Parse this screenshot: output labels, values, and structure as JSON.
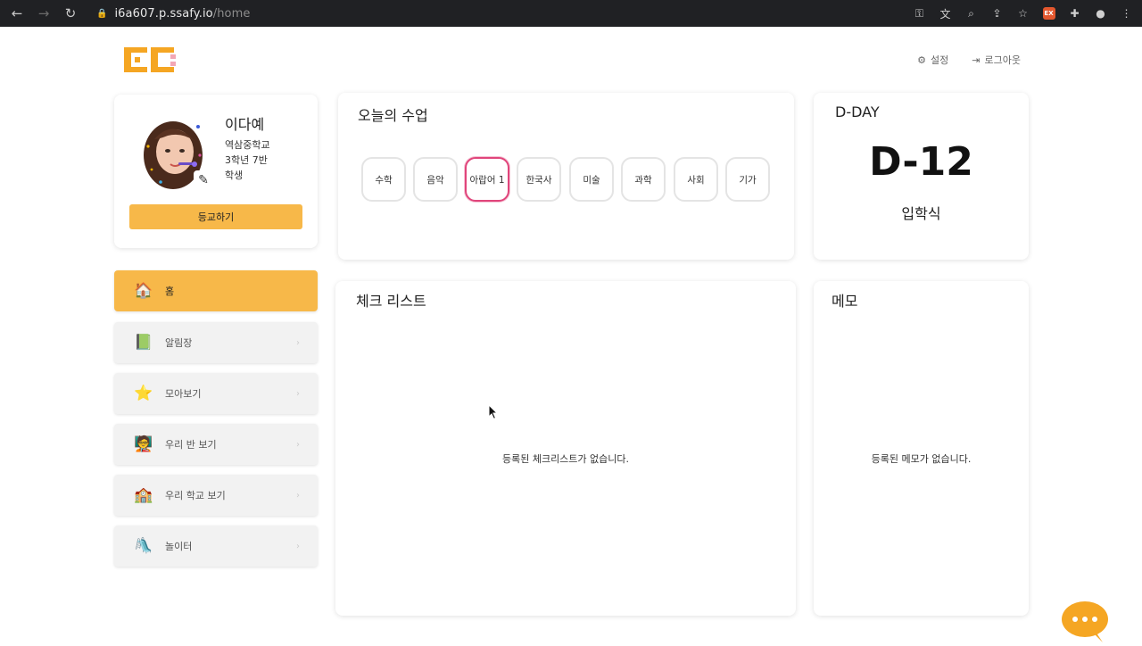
{
  "browser": {
    "url_host": "i6a607.p.ssafy.io",
    "url_path": "/home",
    "ext_badge": "EX"
  },
  "header": {
    "settings_label": "설정",
    "logout_label": "로그아웃"
  },
  "profile": {
    "name": "이다예",
    "school": "역삼중학교",
    "class": "3학년 7반",
    "role": "학생",
    "checkin_label": "등교하기"
  },
  "menu": [
    {
      "label": "홈",
      "icon": "house-icon",
      "active": true
    },
    {
      "label": "알림장",
      "icon": "notebook-icon",
      "active": false
    },
    {
      "label": "모아보기",
      "icon": "star-icon",
      "active": false
    },
    {
      "label": "우리 반 보기",
      "icon": "classroom-icon",
      "active": false
    },
    {
      "label": "우리 학교 보기",
      "icon": "school-icon",
      "active": false
    },
    {
      "label": "놀이터",
      "icon": "slide-icon",
      "active": false
    }
  ],
  "classes": {
    "title": "오늘의 수업",
    "subjects": [
      "수학",
      "음악",
      "아랍어 1",
      "한국사",
      "미술",
      "과학",
      "사회",
      "기가"
    ],
    "current_index": 2
  },
  "dday": {
    "title": "D-DAY",
    "value": "D-12",
    "event": "입학식"
  },
  "checklist": {
    "title": "체크 리스트",
    "empty_text": "등록된 체크리스트가 없습니다."
  },
  "memo": {
    "title": "메모",
    "empty_text": "등록된 메모가 없습니다."
  },
  "colors": {
    "accent": "#f7b849",
    "current_class": "#e0457b"
  }
}
